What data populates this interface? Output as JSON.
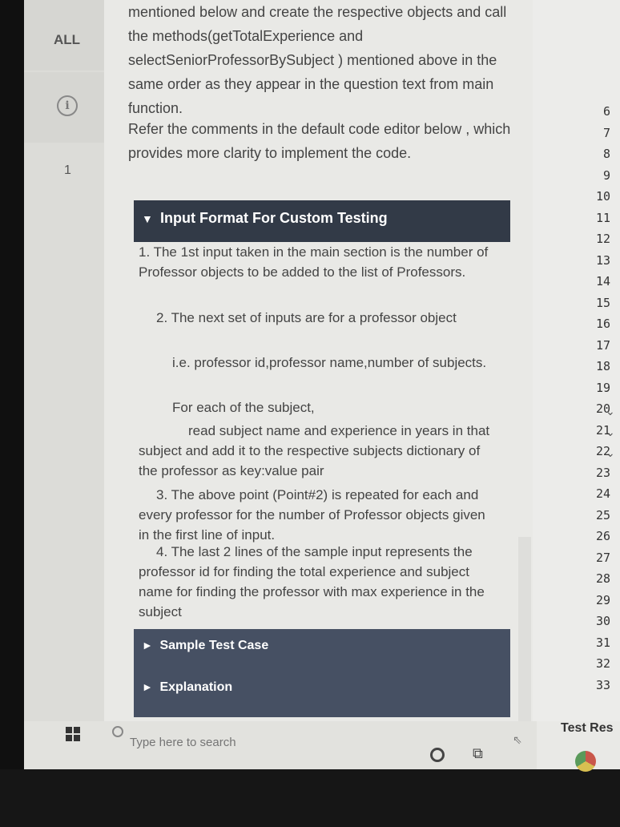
{
  "rail": {
    "all_label": "ALL",
    "info_icon": "info-icon",
    "question_number": "1"
  },
  "question": {
    "paragraph1": "mentioned below and create the respective objects and call the methods(getTotalExperience and selectSeniorProfessorBySubject ) mentioned above in the same order as they appear in the question text from main function.",
    "paragraph2": "Refer the comments in the default code editor below , which provides more clarity to implement the code."
  },
  "input_format": {
    "header": "Input Format For Custom Testing",
    "items": [
      "1.  The 1st input taken in the main section is the number of Professor objects to be added to the list of Professors.",
      "2.  The next set of inputs are for a professor object",
      "i.e. professor id,professor name,number of subjects.",
      "For each of the subject,",
      "read subject name and experience in years in that subject and add it to the respective subjects dictionary of the professor as key:value pair",
      "3. The above point (Point#2) is repeated for each and every professor for the number of Professor objects given in the first line of input.",
      "4. The last 2 lines of the sample input represents the professor id for finding the total experience and subject name for finding the professor with max experience in the subject"
    ]
  },
  "accordions": {
    "sample_test_case": "Sample Test Case",
    "explanation": "Explanation"
  },
  "editor": {
    "line_numbers": [
      "6",
      "7",
      "8",
      "9",
      "10",
      "11",
      "12",
      "13",
      "14",
      "15",
      "16",
      "17",
      "18",
      "19",
      "20",
      "21",
      "22",
      "23",
      "24",
      "25",
      "26",
      "27",
      "28",
      "29",
      "30",
      "31",
      "32",
      "33"
    ]
  },
  "test_results_label": "Test Res",
  "taskbar": {
    "search_placeholder": "Type here to search"
  }
}
